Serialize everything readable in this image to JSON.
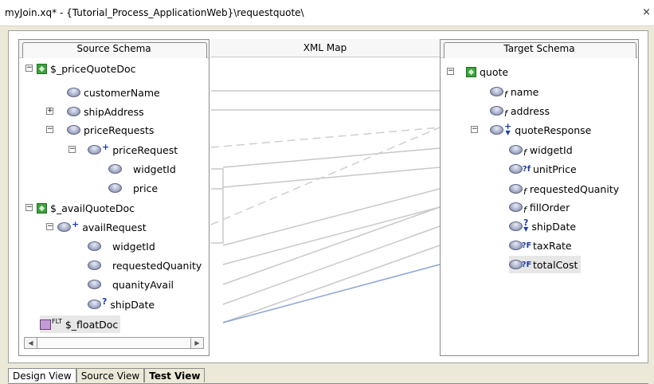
{
  "window": {
    "title": "myJoin.xq* - {Tutorial_Process_ApplicationWeb}\\requestquote\\",
    "close_glyph": "×"
  },
  "source_panel": {
    "header": "Source Schema",
    "nodes": [
      {
        "label": "$_priceQuoteDoc",
        "icon": "root-doc-icon",
        "expander": "−"
      },
      {
        "label": "customerName",
        "icon": "element-icon"
      },
      {
        "label": "shipAddress",
        "icon": "element-icon",
        "expander": "+"
      },
      {
        "label": "priceRequests",
        "icon": "element-icon",
        "expander": "−"
      },
      {
        "label": "priceRequest",
        "icon": "element-icon",
        "expander": "−",
        "modifier": "+"
      },
      {
        "label": "widgetId",
        "icon": "element-icon"
      },
      {
        "label": "price",
        "icon": "element-icon"
      },
      {
        "label": "$_availQuoteDoc",
        "icon": "root-doc-icon",
        "expander": "−"
      },
      {
        "label": "availRequest",
        "icon": "element-icon",
        "expander": "−",
        "modifier": "+"
      },
      {
        "label": "widgetId",
        "icon": "element-icon"
      },
      {
        "label": "requestedQuanity",
        "icon": "element-icon"
      },
      {
        "label": "quanityAvail",
        "icon": "element-icon"
      },
      {
        "label": "shipDate",
        "icon": "element-icon",
        "modifier": "?"
      },
      {
        "label": "$_floatDoc",
        "icon": "float-doc-icon",
        "modifier": "FLT"
      }
    ]
  },
  "map_panel": {
    "header": "XML Map"
  },
  "target_panel": {
    "header": "Target Schema",
    "nodes": [
      {
        "label": "quote",
        "icon": "root-doc-icon",
        "expander": "−"
      },
      {
        "label": "name",
        "icon": "element-icon",
        "modifier": "f"
      },
      {
        "label": "address",
        "icon": "element-icon",
        "modifier": "f"
      },
      {
        "label": "quoteResponse",
        "icon": "element-icon",
        "expander": "−",
        "modifier": "+"
      },
      {
        "label": "widgetId",
        "icon": "element-icon",
        "modifier": "f"
      },
      {
        "label": "unitPrice",
        "icon": "element-icon",
        "modifier": "?f"
      },
      {
        "label": "requestedQuanity",
        "icon": "element-icon",
        "modifier": "f"
      },
      {
        "label": "fillOrder",
        "icon": "element-icon",
        "modifier": "f"
      },
      {
        "label": "shipDate",
        "icon": "element-icon",
        "modifier": "?"
      },
      {
        "label": "taxRate",
        "icon": "element-icon",
        "modifier": "?F"
      },
      {
        "label": "totalCost",
        "icon": "element-icon",
        "modifier": "?F",
        "selected": true
      }
    ]
  },
  "view_tabs": [
    "Design View",
    "Source View",
    "Test View"
  ],
  "colors": {
    "link_gray": "#c8c8c8",
    "link_blue": "#8aa6d6"
  }
}
